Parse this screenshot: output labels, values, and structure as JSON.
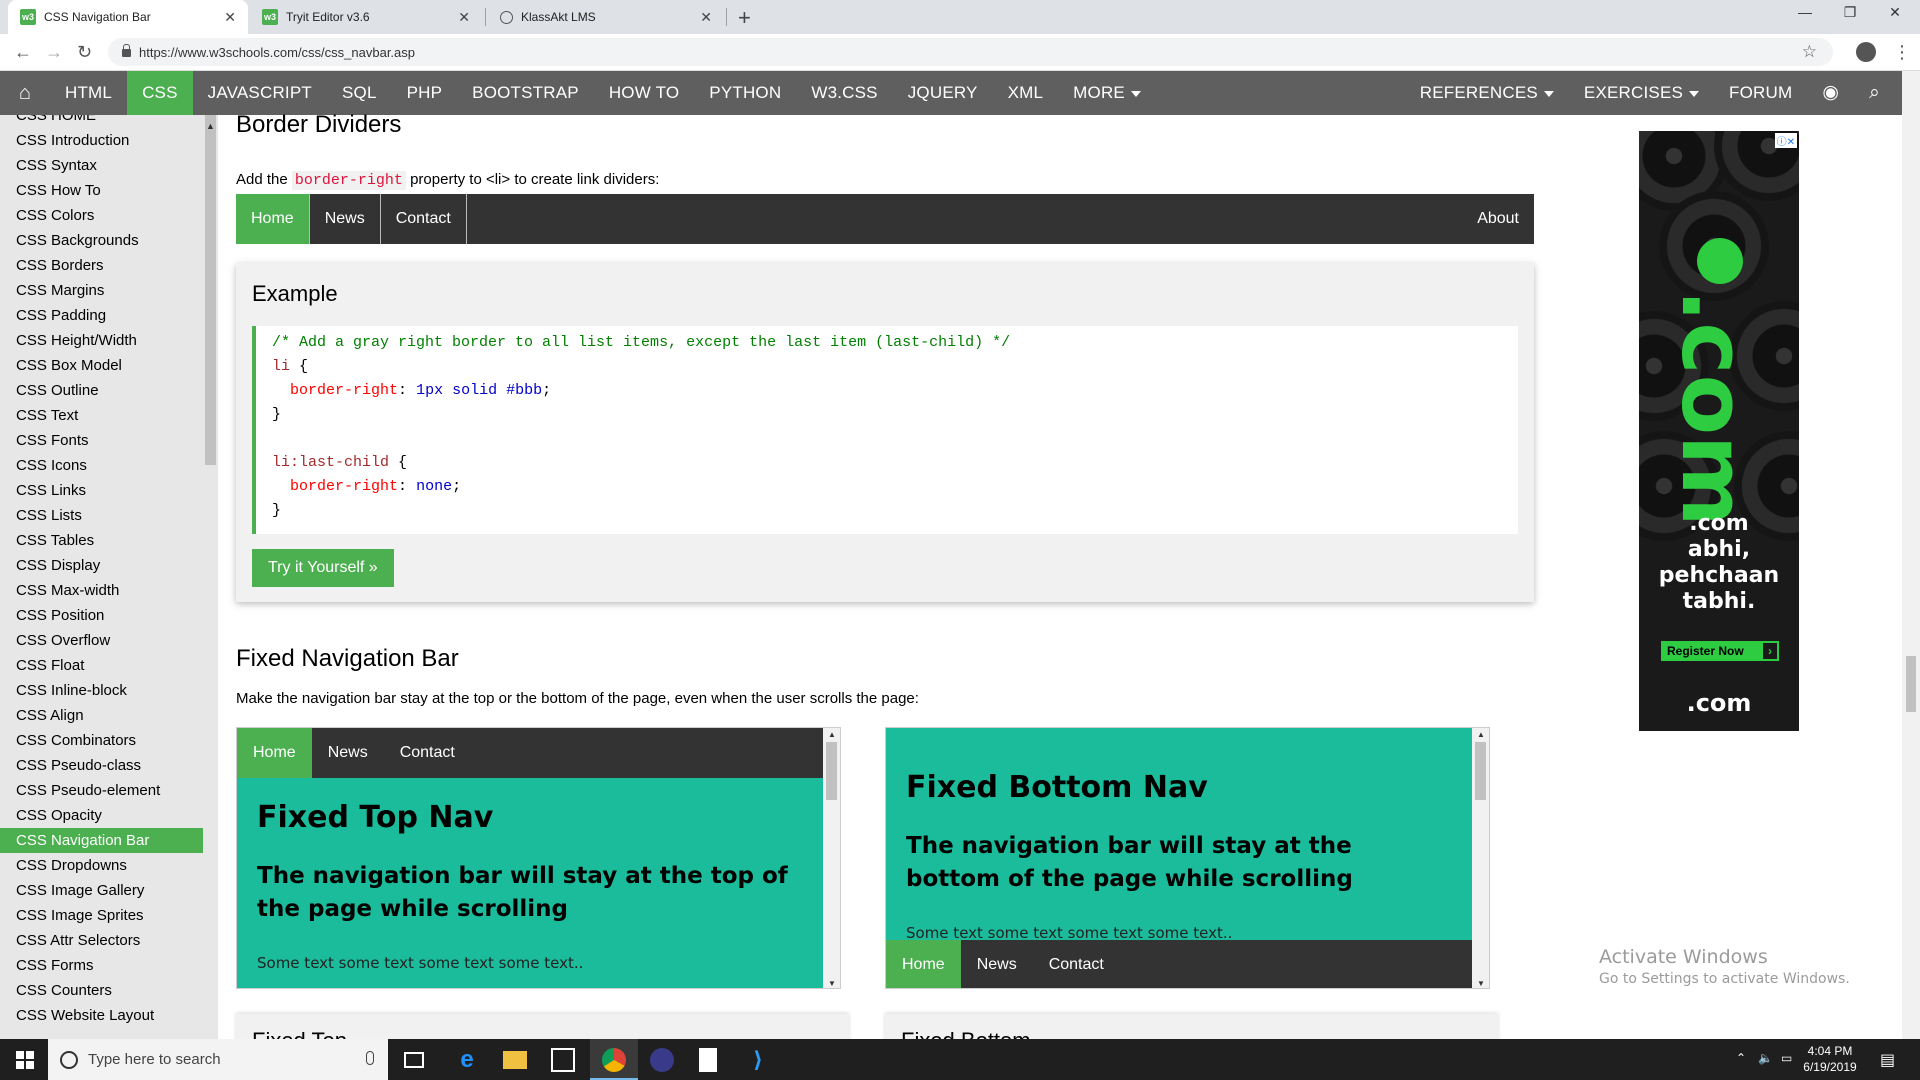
{
  "browser": {
    "tabs": [
      {
        "title": "CSS Navigation Bar",
        "active": true,
        "icon": "w3schools-favicon"
      },
      {
        "title": "Tryit Editor v3.6",
        "active": false,
        "icon": "w3schools-favicon"
      },
      {
        "title": "KlassAkt LMS",
        "active": false,
        "icon": "globe-icon"
      }
    ],
    "url": "https://www.w3schools.com/css/css_navbar.asp"
  },
  "topnav": {
    "items": [
      "HTML",
      "CSS",
      "JAVASCRIPT",
      "SQL",
      "PHP",
      "BOOTSTRAP",
      "HOW TO",
      "PYTHON",
      "W3.CSS",
      "JQUERY",
      "XML",
      "MORE"
    ],
    "active": "CSS",
    "right_items": [
      "REFERENCES",
      "EXERCISES",
      "FORUM"
    ],
    "accent": "#4caf50",
    "bg": "#5f5f5f"
  },
  "sidebar": {
    "items": [
      "CSS HOME",
      "CSS Introduction",
      "CSS Syntax",
      "CSS How To",
      "CSS Colors",
      "CSS Backgrounds",
      "CSS Borders",
      "CSS Margins",
      "CSS Padding",
      "CSS Height/Width",
      "CSS Box Model",
      "CSS Outline",
      "CSS Text",
      "CSS Fonts",
      "CSS Icons",
      "CSS Links",
      "CSS Lists",
      "CSS Tables",
      "CSS Display",
      "CSS Max-width",
      "CSS Position",
      "CSS Overflow",
      "CSS Float",
      "CSS Inline-block",
      "CSS Align",
      "CSS Combinators",
      "CSS Pseudo-class",
      "CSS Pseudo-element",
      "CSS Opacity",
      "CSS Navigation Bar",
      "CSS Dropdowns",
      "CSS Image Gallery",
      "CSS Image Sprites",
      "CSS Attr Selectors",
      "CSS Forms",
      "CSS Counters",
      "CSS Website Layout"
    ],
    "active": "CSS Navigation Bar"
  },
  "main": {
    "border_dividers": {
      "heading": "Border Dividers",
      "para_before": "Add the",
      "para_code": "border-right",
      "para_after": "property to <li> to create link dividers:",
      "demo_links": [
        "Home",
        "News",
        "Contact"
      ],
      "demo_right": "About"
    },
    "example": {
      "heading": "Example",
      "code": {
        "comment": "/* Add a gray right border to all list items, except the last item (last-child) */",
        "sel1": "li",
        "prop1": "border-right",
        "val1": "1px solid #bbb",
        "sel2": "li:last-child",
        "prop2": "border-right",
        "val2": "none"
      },
      "try_button": "Try it Yourself »"
    },
    "fixed": {
      "heading": "Fixed Navigation Bar",
      "para": "Make the navigation bar stay at the top or the bottom of the page, even when the user scrolls the page:",
      "top_frame": {
        "nav": [
          "Home",
          "News",
          "Contact"
        ],
        "h1": "Fixed Top Nav",
        "h2": "The navigation bar will stay at the top of the page while scrolling",
        "text": "Some text some text some text some text.."
      },
      "bottom_frame": {
        "nav": [
          "Home",
          "News",
          "Contact"
        ],
        "h1": "Fixed Bottom Nav",
        "h2": "The navigation bar will stay at the bottom of the page while scrolling",
        "text": "Some text some text some text some text.."
      },
      "teal": "#1abc9c",
      "peek_left": "Fixed Top",
      "peek_right": "Fixed Bottom"
    }
  },
  "ad": {
    "big": ".com",
    "lines": [
      ".com",
      "abhi,",
      "pehchaan",
      "tabhi."
    ],
    "button": "Register Now",
    "footer": ".com"
  },
  "watermark": {
    "title": "Activate Windows",
    "subtitle": "Go to Settings to activate Windows."
  },
  "taskbar": {
    "search_placeholder": "Type here to search",
    "time": "4:04 PM",
    "date": "6/19/2019"
  }
}
